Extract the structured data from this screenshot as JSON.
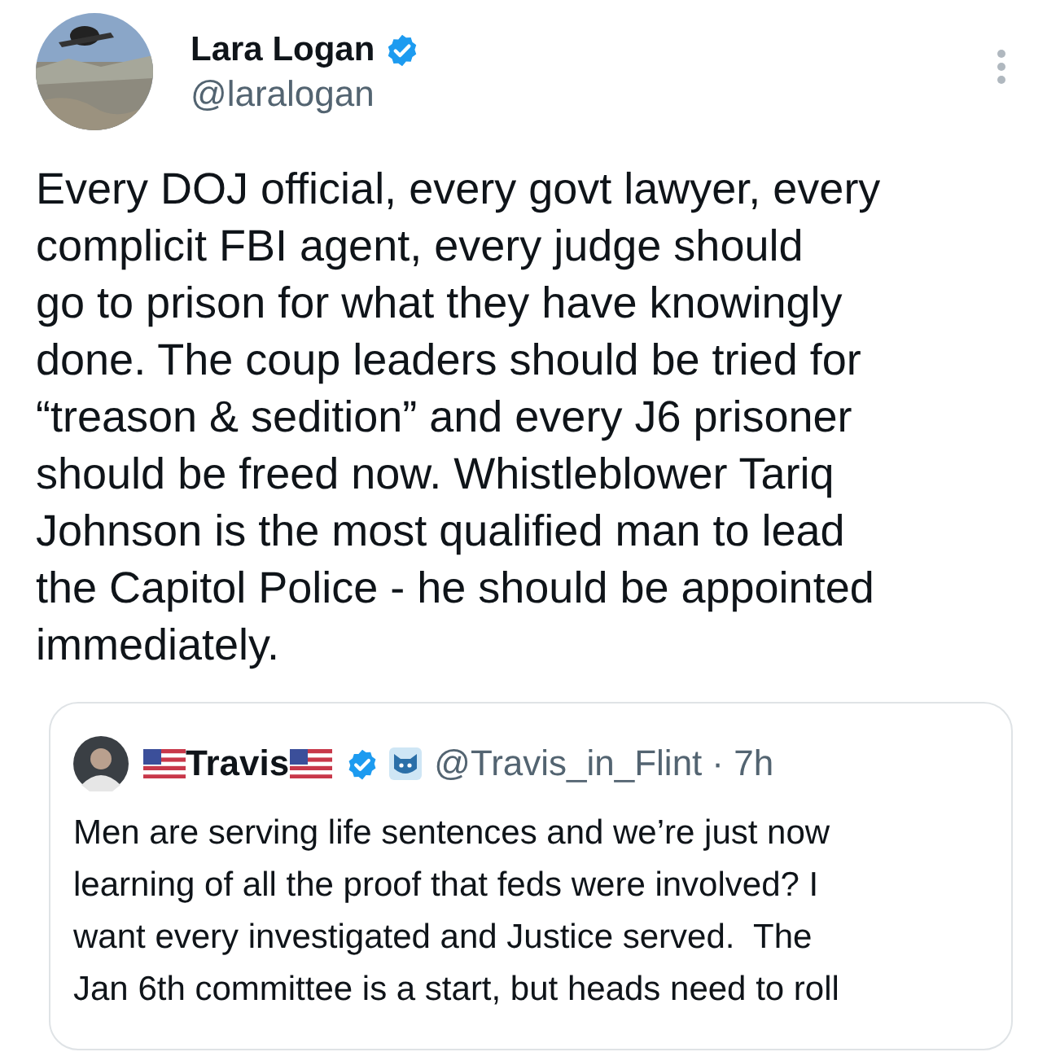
{
  "author": {
    "name": "Lara Logan",
    "handle": "@laralogan",
    "verified": true
  },
  "body_lines": [
    "Every DOJ official, every govt lawyer, every",
    "complicit FBI agent, every judge should",
    "go to prison for what they have knowingly",
    "done. The coup leaders should be tried for",
    "“treason & sedition” and every J6 prisoner",
    "should be freed now. Whistleblower Tariq",
    "Johnson is the most qualified man to lead",
    "the Capitol Police - he should be appointed",
    "immediately."
  ],
  "quoted": {
    "name": "Travis",
    "verified": true,
    "handle": "@Travis_in_Flint",
    "time": "· 7h",
    "lines": [
      "Men are serving life sentences and we’re just now",
      "learning of all the proof that feds were involved? I",
      "want every investigated and Justice served.  The",
      "Jan 6th committee is a start, but heads need to roll"
    ]
  }
}
